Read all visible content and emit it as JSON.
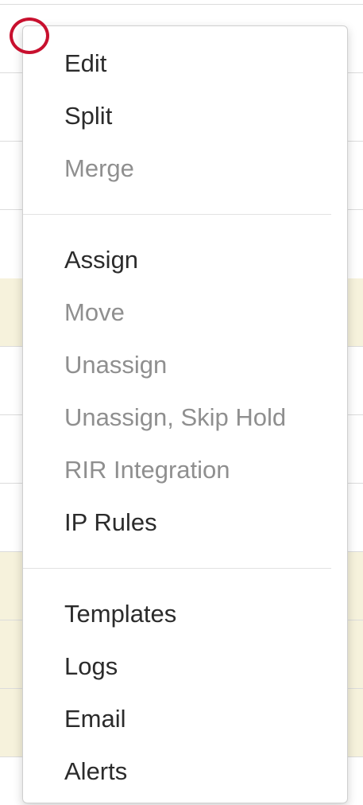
{
  "menu": {
    "groups": [
      {
        "items": [
          {
            "label": "Edit",
            "disabled": false
          },
          {
            "label": "Split",
            "disabled": false
          },
          {
            "label": "Merge",
            "disabled": true
          }
        ]
      },
      {
        "items": [
          {
            "label": "Assign",
            "disabled": false
          },
          {
            "label": "Move",
            "disabled": true
          },
          {
            "label": "Unassign",
            "disabled": true
          },
          {
            "label": "Unassign, Skip Hold",
            "disabled": true
          },
          {
            "label": "RIR Integration",
            "disabled": true
          },
          {
            "label": "IP Rules",
            "disabled": false
          }
        ]
      },
      {
        "items": [
          {
            "label": "Templates",
            "disabled": false
          },
          {
            "label": "Logs",
            "disabled": false
          },
          {
            "label": "Email",
            "disabled": false
          },
          {
            "label": "Alerts",
            "disabled": false
          }
        ]
      }
    ]
  },
  "colors": {
    "annotation": "#c8102e",
    "row_highlight": "#f6f2dc",
    "enabled_text": "#2b2b2b",
    "disabled_text": "#8f8f8f"
  }
}
